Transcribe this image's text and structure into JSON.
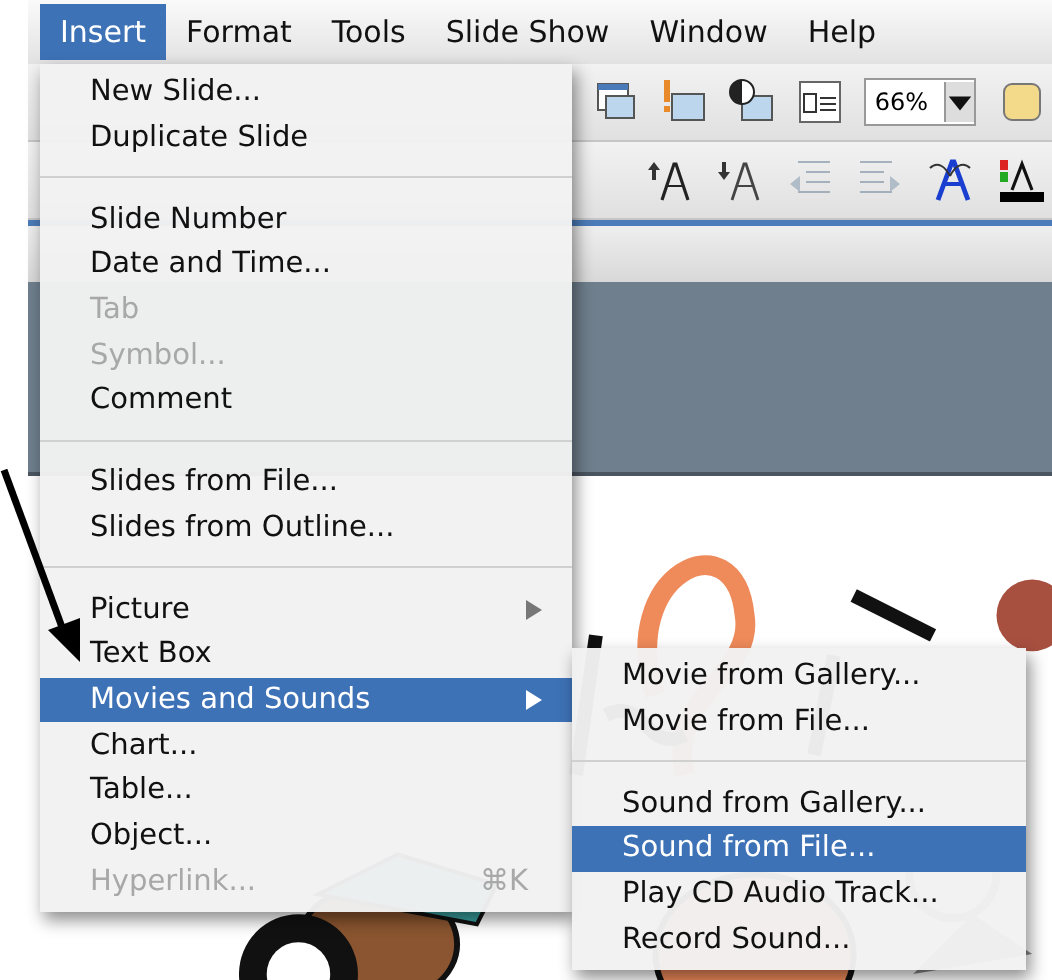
{
  "menu_bar": [
    {
      "label": "Insert",
      "selected": true
    },
    {
      "label": "Format",
      "selected": false
    },
    {
      "label": "Tools",
      "selected": false
    },
    {
      "label": "Slide Show",
      "selected": false
    },
    {
      "label": "Window",
      "selected": false
    },
    {
      "label": "Help",
      "selected": false
    }
  ],
  "toolbar": {
    "zoom": "66%"
  },
  "insert_menu": {
    "items": [
      {
        "kind": "item",
        "label": "New Slide...",
        "disabled": false,
        "selected": false
      },
      {
        "kind": "item",
        "label": "Duplicate Slide",
        "disabled": false,
        "selected": false
      },
      {
        "kind": "separator"
      },
      {
        "kind": "item",
        "label": "Slide Number",
        "disabled": false,
        "selected": false
      },
      {
        "kind": "item",
        "label": "Date and Time...",
        "disabled": false,
        "selected": false
      },
      {
        "kind": "item",
        "label": "Tab",
        "disabled": true,
        "selected": false
      },
      {
        "kind": "item",
        "label": "Symbol...",
        "disabled": true,
        "selected": false
      },
      {
        "kind": "item",
        "label": "Comment",
        "disabled": false,
        "selected": false
      },
      {
        "kind": "separator"
      },
      {
        "kind": "item",
        "label": "Slides from File...",
        "disabled": false,
        "selected": false
      },
      {
        "kind": "item",
        "label": "Slides from Outline...",
        "disabled": false,
        "selected": false
      },
      {
        "kind": "separator"
      },
      {
        "kind": "submenu",
        "label": "Picture",
        "disabled": false,
        "selected": false
      },
      {
        "kind": "item",
        "label": "Text Box",
        "disabled": false,
        "selected": false
      },
      {
        "kind": "submenu",
        "label": "Movies and Sounds",
        "disabled": false,
        "selected": true
      },
      {
        "kind": "item",
        "label": "Chart...",
        "disabled": false,
        "selected": false
      },
      {
        "kind": "item",
        "label": "Table...",
        "disabled": false,
        "selected": false
      },
      {
        "kind": "item",
        "label": "Object...",
        "disabled": false,
        "selected": false
      },
      {
        "kind": "item",
        "label": "Hyperlink...",
        "disabled": true,
        "selected": false,
        "shortcut": "⌘K"
      }
    ]
  },
  "submenu": {
    "items": [
      {
        "kind": "item",
        "label": "Movie from Gallery...",
        "selected": false
      },
      {
        "kind": "item",
        "label": "Movie from File...",
        "selected": false
      },
      {
        "kind": "separator"
      },
      {
        "kind": "item",
        "label": "Sound from Gallery...",
        "selected": false
      },
      {
        "kind": "item",
        "label": "Sound from File...",
        "selected": true
      },
      {
        "kind": "item",
        "label": "Play CD Audio Track...",
        "selected": false
      },
      {
        "kind": "item",
        "label": "Record Sound...",
        "selected": false
      }
    ]
  }
}
